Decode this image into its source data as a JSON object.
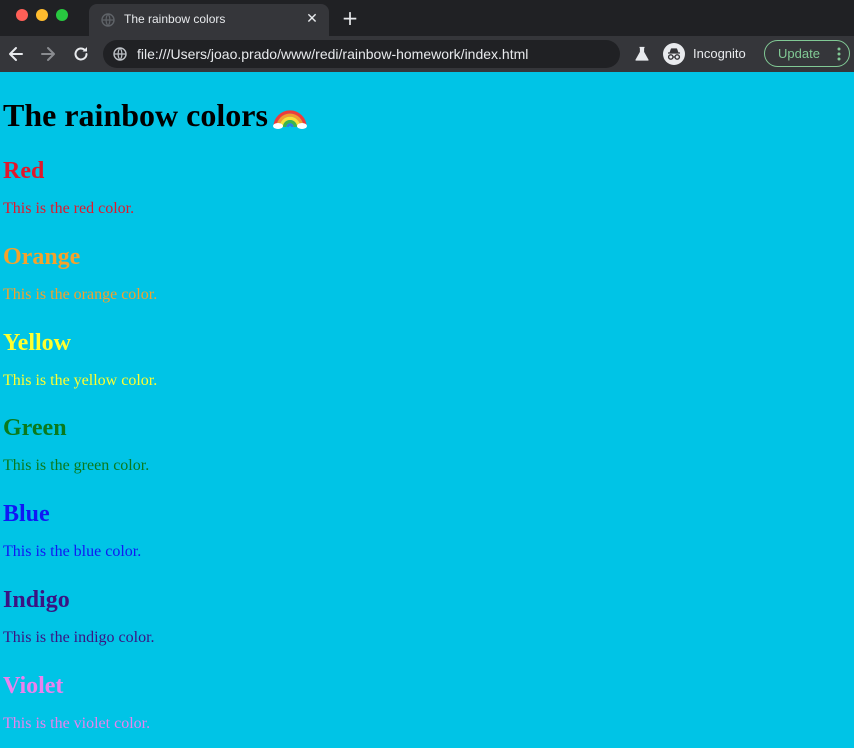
{
  "browser": {
    "tab_title": "The rainbow colors",
    "url": "file:///Users/joao.prado/www/redi/rainbow-homework/index.html",
    "incognito_label": "Incognito",
    "update_label": "Update",
    "accent_update": "#81c995"
  },
  "page": {
    "background": "#00c4e6",
    "title": "The rainbow colors",
    "title_emoji": "rainbow-emoji",
    "sections": [
      {
        "heading": "Red",
        "text": "This is the red color.",
        "color": "#e2172b"
      },
      {
        "heading": "Orange",
        "text": "This is the orange color.",
        "color": "#f5a22b"
      },
      {
        "heading": "Yellow",
        "text": "This is the yellow color.",
        "color": "#ffff2e"
      },
      {
        "heading": "Green",
        "text": "This is the green color.",
        "color": "#0a7a1d"
      },
      {
        "heading": "Blue",
        "text": "This is the blue color.",
        "color": "#1018f5"
      },
      {
        "heading": "Indigo",
        "text": "This is the indigo color.",
        "color": "#3a1483"
      },
      {
        "heading": "Violet",
        "text": "This is the violet color.",
        "color": "#ea82ee"
      }
    ]
  }
}
